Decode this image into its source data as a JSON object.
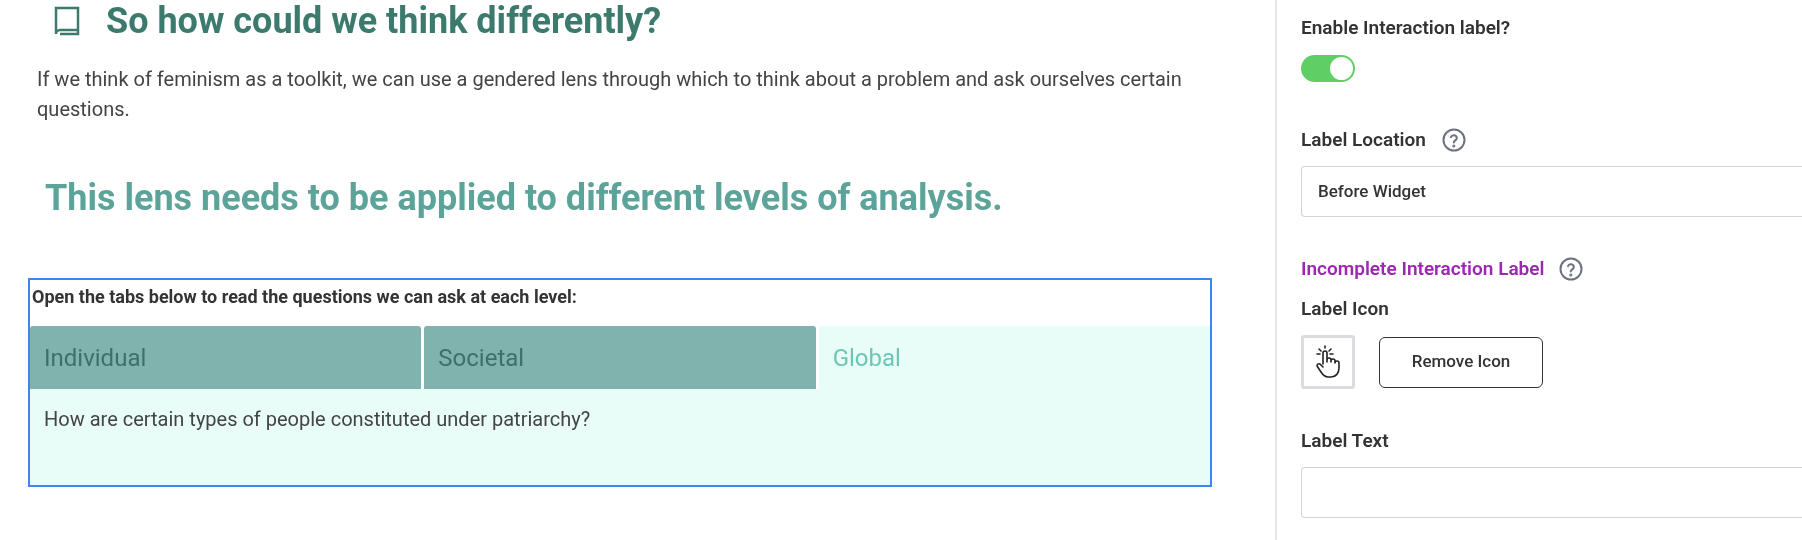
{
  "article": {
    "heading": "So how could we think differently?",
    "intro": "If we think of feminism as a toolkit, we can use a gendered lens through which to think about a problem and ask ourselves certain questions.",
    "callout": "This lens needs to be applied to different levels of analysis.",
    "tab_widget": {
      "instruction": "Open the tabs below to read the questions we can ask at each level:",
      "tabs": [
        {
          "label": "Individual",
          "selected": false
        },
        {
          "label": "Societal",
          "selected": false
        },
        {
          "label": "Global",
          "selected": true
        }
      ],
      "panel_text": "How are certain types of people constituted under patriarchy?"
    }
  },
  "settings": {
    "enable_label": {
      "label": "Enable Interaction label?",
      "on": true
    },
    "label_location": {
      "label": "Label Location",
      "value": "Before Widget"
    },
    "incomplete_label": {
      "label": "Incomplete Interaction Label"
    },
    "label_icon": {
      "label": "Label Icon",
      "remove_button": "Remove Icon"
    },
    "label_text": {
      "label": "Label Text"
    }
  }
}
